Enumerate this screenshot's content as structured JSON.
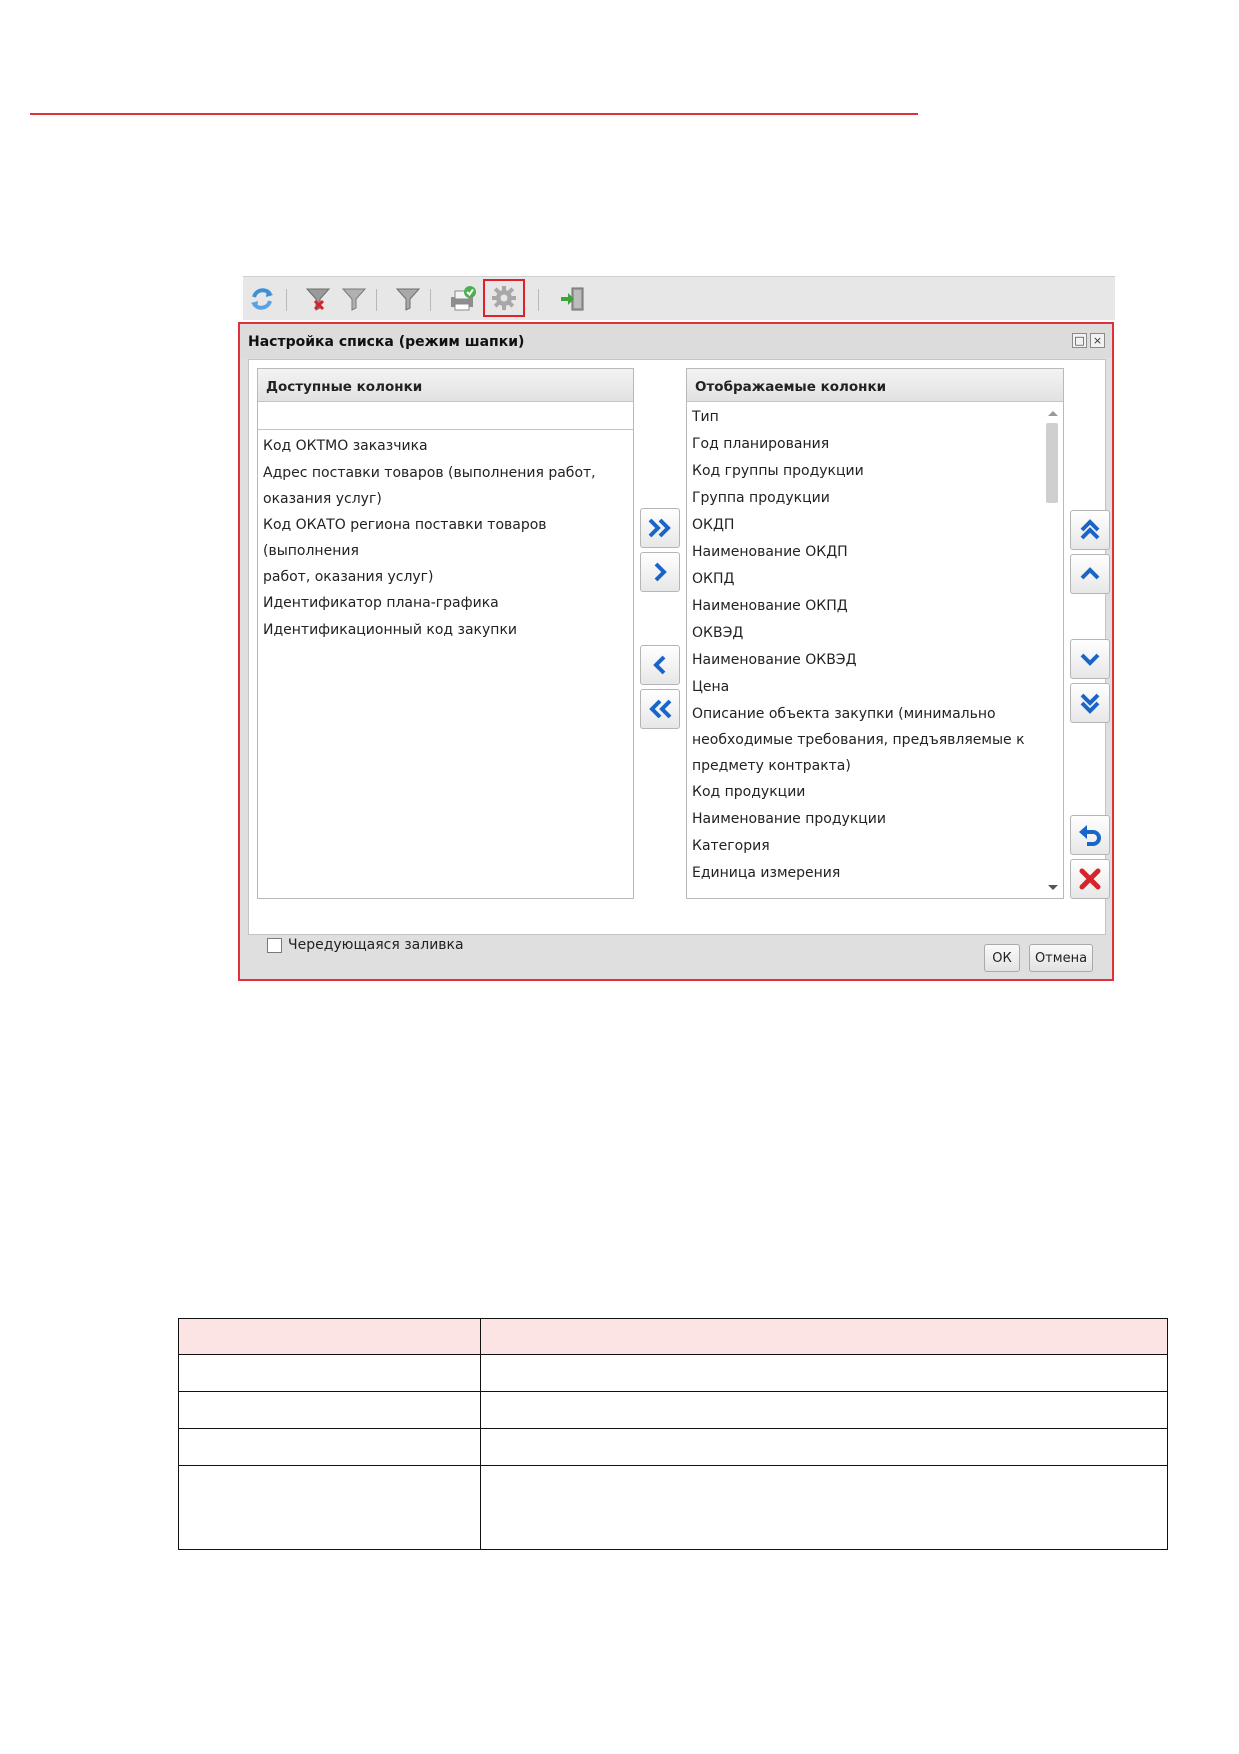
{
  "dialog": {
    "title": "Настройка списка (режим шапки)",
    "maximize_glyph": "□",
    "close_glyph": "×"
  },
  "available": {
    "header": "Доступные колонки",
    "filter_value": "",
    "items": [
      "Код ОКТМО заказчика",
      "Адрес поставки товаров (выполнения работ,\nоказания услуг)",
      "Код ОКАТО региона поставки товаров (выполнения\nработ, оказания услуг)",
      "Идентификатор плана-графика",
      "Идентификационный код закупки"
    ]
  },
  "displayed": {
    "header": "Отображаемые колонки",
    "items": [
      "Тип",
      "Год планирования",
      "Код группы продукции",
      "Группа продукции",
      "ОКДП",
      "Наименование ОКДП",
      "ОКПД",
      "Наименование ОКПД",
      "ОКВЭД",
      "Наименование ОКВЭД",
      "Цена",
      "Описание объекта закупки (минимально\nнеобходимые требования, предъявляемые к\nпредмету контракта)",
      "Код продукции",
      "Наименование продукции",
      "Категория",
      "Единица измерения"
    ]
  },
  "options": {
    "alternating_fill_label": "Чередующаяся заливка",
    "alternating_fill_checked": false
  },
  "footer": {
    "ok_label": "ОК",
    "cancel_label": "Отмена"
  },
  "colors": {
    "highlight_red": "#e0303a",
    "arrow_blue": "#1a66c8",
    "delete_red": "#d9232b",
    "table_header_fill": "#fde4e4"
  },
  "table": {
    "rows": 5
  }
}
